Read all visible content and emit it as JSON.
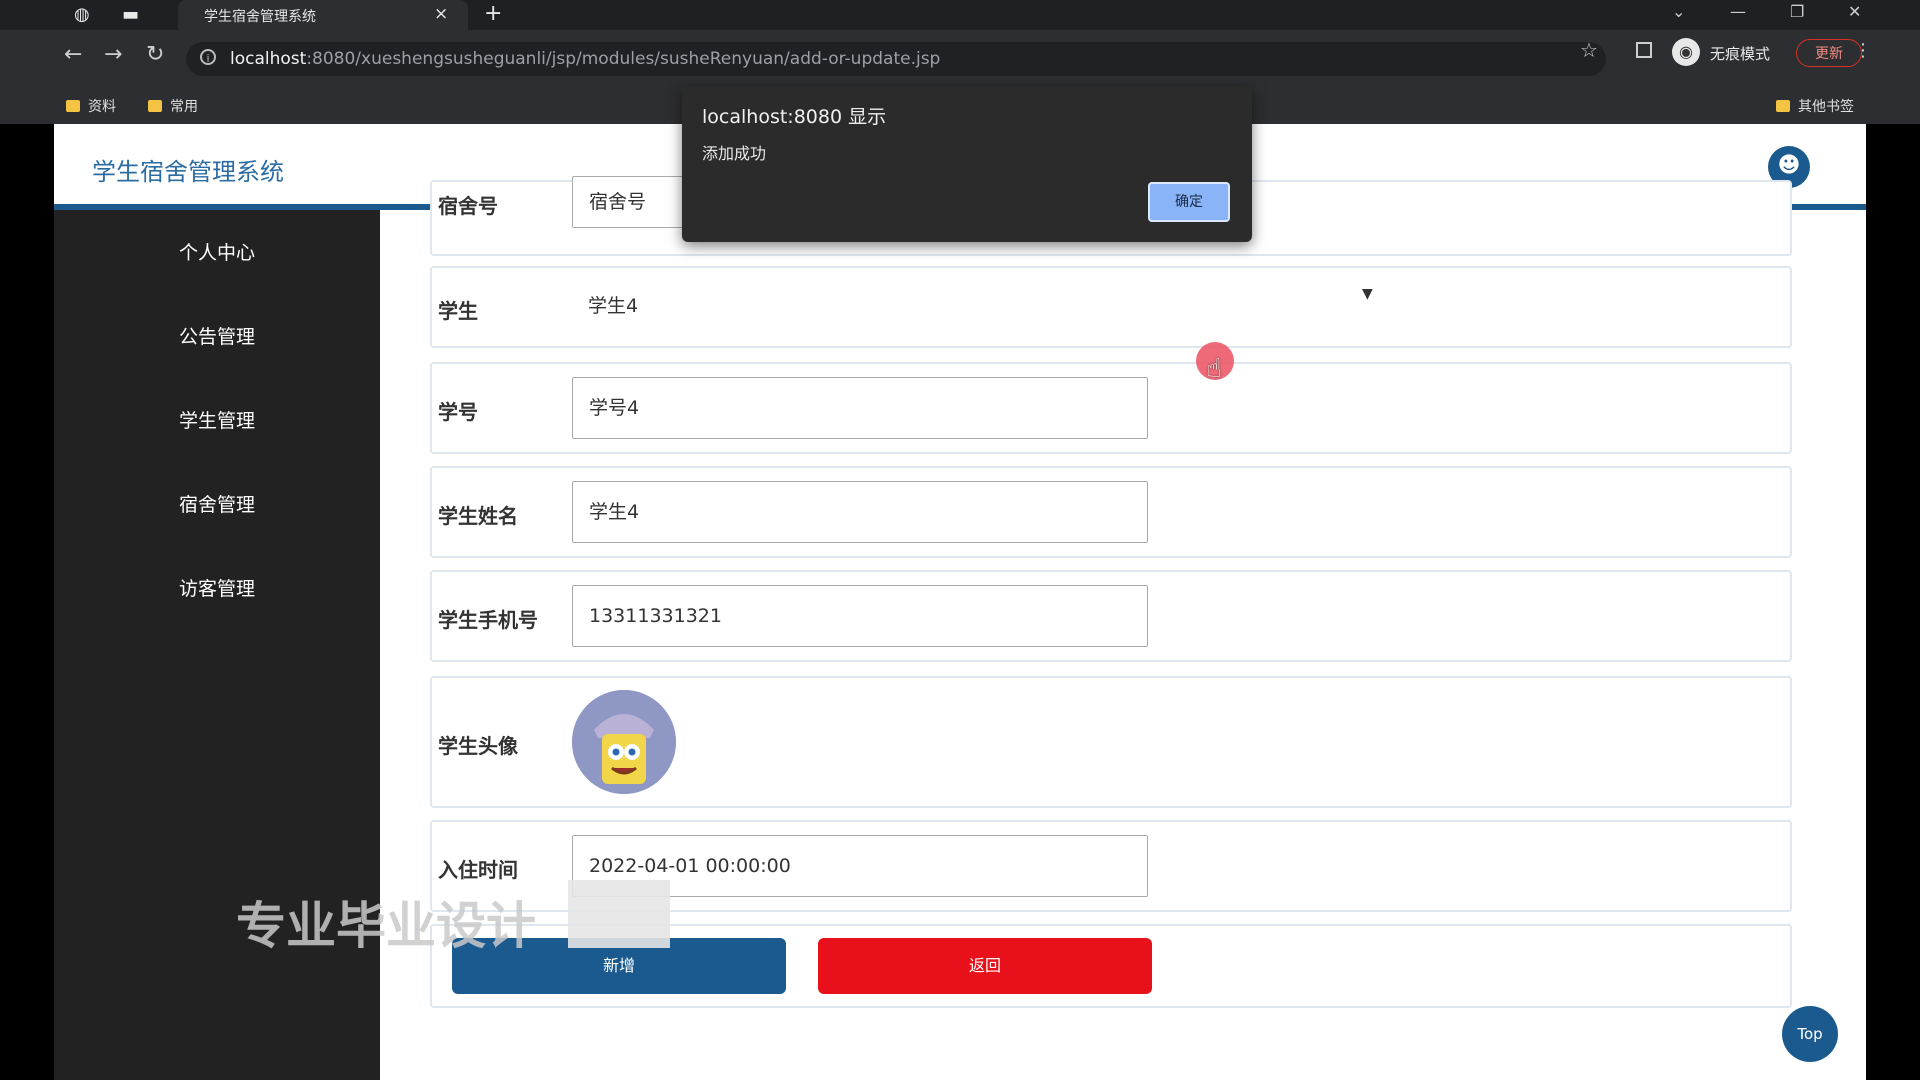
{
  "browser": {
    "tab_title": "学生宿舍管理系统",
    "tab_close": "×",
    "new_tab": "+",
    "url_host": "localhost",
    "url_rest": ":8080/xueshengsusheguanli/jsp/modules/susheRenyuan/add-or-update.jsp",
    "incognito_label": "无痕模式",
    "update_label": "更新",
    "bookmarks": [
      "资料",
      "常用"
    ],
    "other_bookmarks": "其他书签"
  },
  "header": {
    "site_title": "学生宿舍管理系统"
  },
  "sidebar": {
    "items": [
      {
        "label": "个人中心"
      },
      {
        "label": "公告管理"
      },
      {
        "label": "学生管理"
      },
      {
        "label": "宿舍管理"
      },
      {
        "label": "访客管理"
      }
    ]
  },
  "form": {
    "dorm_partial": "宿舍号",
    "student_label": "学生",
    "student_value": "学生4",
    "student_no_label": "学号",
    "student_no_value": "学号4",
    "name_label": "学生姓名",
    "name_value": "学生4",
    "phone_label": "学生手机号",
    "phone_value": "13311331321",
    "avatar_label": "学生头像",
    "checkin_label": "入住时间",
    "checkin_value": "2022-04-01 00:00:00",
    "add_button": "新增",
    "back_button": "返回"
  },
  "dialog": {
    "title": "localhost:8080 显示",
    "message": "添加成功",
    "ok": "确定"
  },
  "watermark": "专业毕业设计",
  "top_button": "Top",
  "colors": {
    "primary": "#1b5a8e",
    "danger": "#e8101a",
    "sidebar": "#222222"
  }
}
